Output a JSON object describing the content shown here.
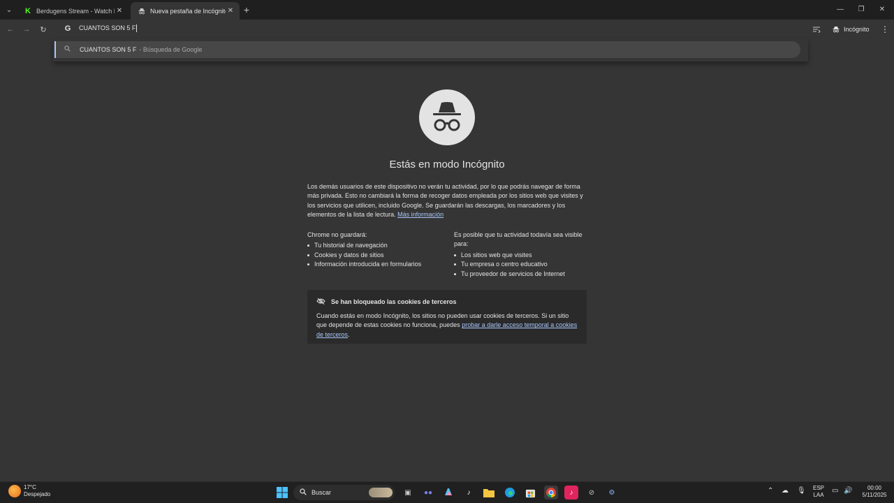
{
  "tabs": [
    {
      "title": "Berdugens Stream - Watch Live",
      "icon": "kick-icon",
      "color": "#53fc18"
    },
    {
      "title": "Nueva pestaña de Incógnito",
      "icon": "incognito-icon"
    }
  ],
  "toolbar": {
    "omnibox_value": "CUANTOS SON 5 F",
    "incognito_label": "Incógnito"
  },
  "suggestion": {
    "query": "CUANTOS SON 5 F",
    "description": "- Búsqueda de Google"
  },
  "page": {
    "heading": "Estás en modo Incógnito",
    "intro": "Los demás usuarios de este dispositivo no verán tu actividad, por lo que podrás navegar de forma más privada. Esto no cambiará la forma de recoger datos empleada por los sitios web que visites y los servicios que utilicen, incluido Google. Se guardarán las descargas, los marcadores y los elementos de la lista de lectura.",
    "more_info": "Más información",
    "not_saved_title": "Chrome no guardará:",
    "not_saved_items": [
      "Tu historial de navegación",
      "Cookies y datos de sitios",
      "Información introducida en formularios"
    ],
    "visible_title": "Es posible que tu actividad todavía sea visible para:",
    "visible_items": [
      "Los sitios web que visites",
      "Tu empresa o centro educativo",
      "Tu proveedor de servicios de Internet"
    ],
    "cookie_title": "Se han bloqueado las cookies de terceros",
    "cookie_body": "Cuando estás en modo Incógnito, los sitios no pueden usar cookies de terceros. Si un sitio que depende de estas cookies no funciona, puedes",
    "cookie_link": "probar a darle acceso temporal a cookies de terceros",
    "cookie_end": "."
  },
  "taskbar": {
    "temperature": "17°C",
    "weather": "Despejado",
    "search_placeholder": "Buscar",
    "lang_top": "ESP",
    "lang_bottom": "LAA",
    "time": "00:00",
    "date": "5/11/2025"
  }
}
